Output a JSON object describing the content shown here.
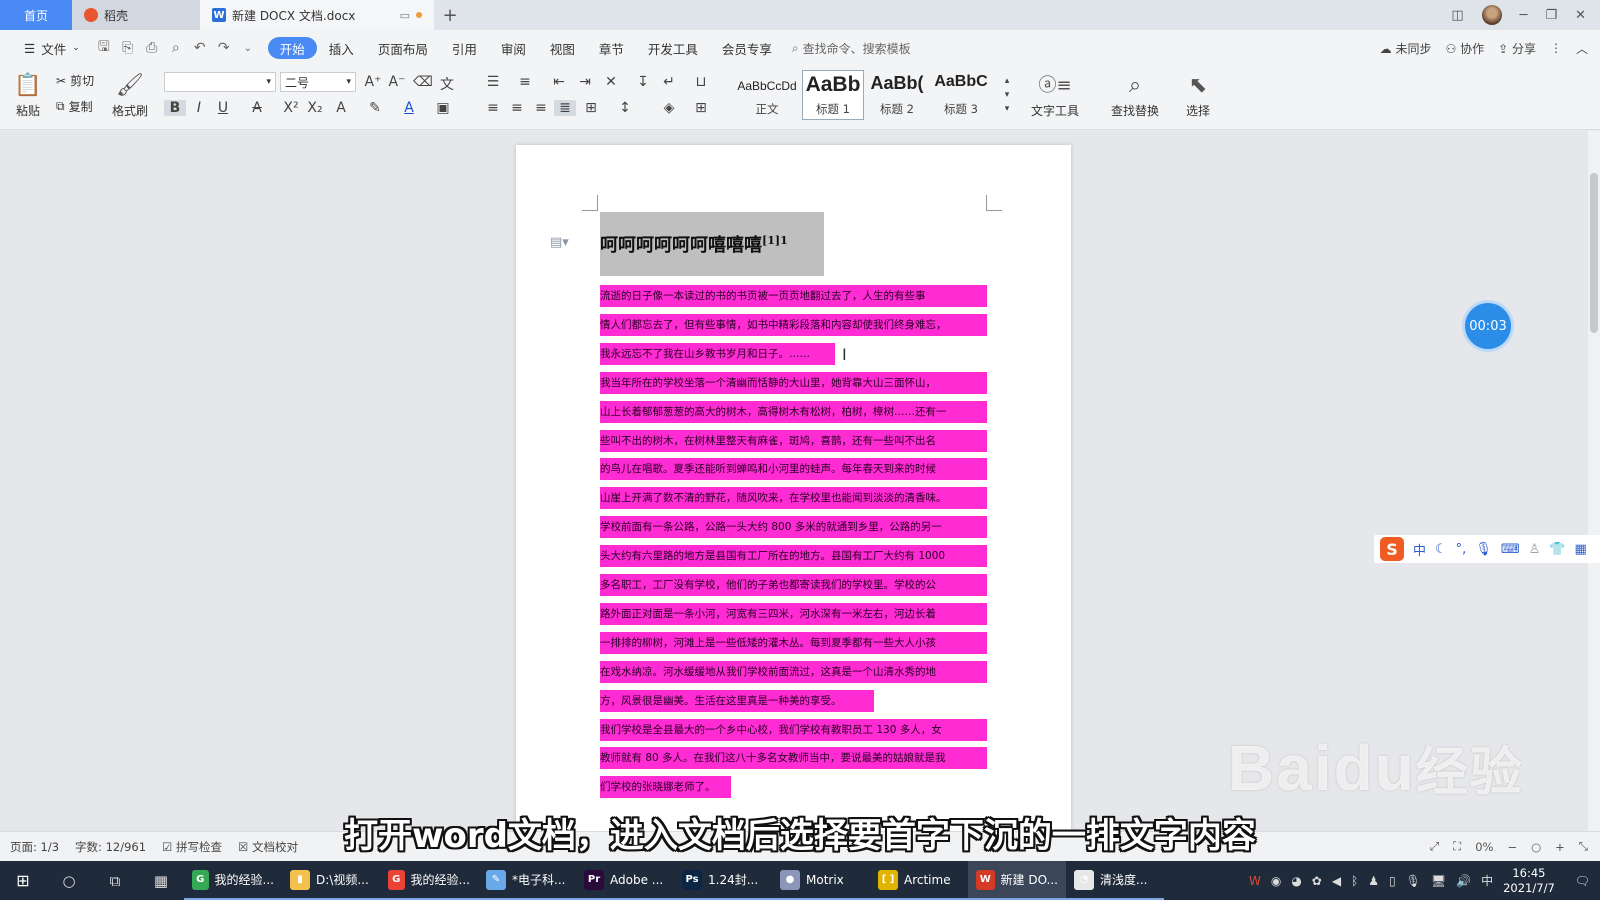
{
  "tabs": {
    "home": "首页",
    "daoke": "稻壳",
    "doc": "新建 DOCX 文档.docx",
    "add": "+"
  },
  "menubar": {
    "file": "文件",
    "items": [
      "开始",
      "插入",
      "页面布局",
      "引用",
      "审阅",
      "视图",
      "章节",
      "开发工具",
      "会员专享"
    ],
    "search": "查找命令、搜索模板",
    "unsynced": "未同步",
    "collab": "协作",
    "share": "分享"
  },
  "ribbon": {
    "paste": "粘贴",
    "cut": "剪切",
    "copy": "复制",
    "format_painter": "格式刷",
    "font_name": "",
    "font_size": "二号",
    "styles": [
      {
        "sample": "AaBbCcDd",
        "label": "正文"
      },
      {
        "sample": "AaBb",
        "label": "标题 1"
      },
      {
        "sample": "AaBb(",
        "label": "标题 2"
      },
      {
        "sample": "AaBbC",
        "label": "标题 3"
      }
    ],
    "text_tools": "文字工具",
    "find_replace": "查找替换",
    "select": "选择"
  },
  "document": {
    "title": "呵呵呵呵呵呵嘻嘻嘻",
    "title_sup": "[1]",
    "title_tail": "1",
    "lines": [
      "  流逝的日子像一本读过的书的书页被一页页地翻过去了，人生的有些事",
      "情人们都忘去了，但有些事情，如书中精彩段落和内容却使我们终身难忘，",
      "我永远忘不了我在山乡教书岁月和日子。……",
      "我当年所在的学校坐落一个清幽而恬静的大山里，她背靠大山三面怀山，",
      "山上长着郁郁葱葱的高大的树木，高得树木有松树，柏树，樟树……还有一",
      "些叫不出的树木，在树林里整天有麻雀，斑鸠，喜鹊，还有一些叫不出名",
      "的鸟儿在唱歌。夏季还能听到蝉鸣和小河里的蛙声。每年春天到来的时候",
      "山崖上开满了数不清的野花，随风吹来，在学校里也能闻到淡淡的清香味。",
      "学校前面有一条公路，公路一头大约 800 多米的就通到乡里，公路的另一",
      "头大约有六里路的地方是县国有工厂所在的地方。县国有工厂大约有 1000",
      "多名职工，工厂没有学校，他们的子弟也都寄读我们的学校里。学校的公",
      "路外面正对面是一条小河，河宽有三四米，河水深有一米左右，河边长着",
      "一排排的柳树，河滩上是一些低矮的灌木丛。每到夏季都有一些大人小孩",
      "在戏水纳凉。河水缓缓地从我们学校前面流过，这真是一个山清水秀的地",
      "方，风景很是幽美。生活在这里真是一种美的享受。",
      "我们学校是全县最大的一个乡中心校，我们学校有教职员工 130 多人，女",
      "教师就有 80 多人。在我们这八十多名女教师当中，要说最美的姑娘就是我",
      "们学校的张晓娜老师了。"
    ],
    "line_widths": [
      1,
      1,
      0.606,
      1,
      1,
      1,
      1,
      1,
      1,
      1,
      1,
      1,
      1,
      1,
      0.708,
      1,
      1,
      0.338
    ]
  },
  "timer": "00:03",
  "ime": {
    "lang": "中"
  },
  "status": {
    "page": "页面: 1/3",
    "words": "字数: 12/961",
    "spell": "拼写检查",
    "proof": "文档校对",
    "zoom": "0%"
  },
  "caption": "打开word文档，进入文档后选择要首字下沉的一排文字内容",
  "watermark": {
    "brand": "Baidu",
    "cn": "经验"
  },
  "taskbar": {
    "apps": [
      {
        "label": "我的经验...",
        "color": "#34a853",
        "glyph": "G"
      },
      {
        "label": "D:\\视频...",
        "color": "#f2c14e",
        "glyph": "▮"
      },
      {
        "label": "我的经验...",
        "color": "#ea4335",
        "glyph": "G"
      },
      {
        "label": "*电子科...",
        "color": "#6aa9e9",
        "glyph": "✎"
      },
      {
        "label": "Adobe ...",
        "color": "#2a0a3a",
        "glyph": "Pr"
      },
      {
        "label": "1.24封...",
        "color": "#0b2545",
        "glyph": "Ps"
      },
      {
        "label": "Motrix",
        "color": "#8c96b8",
        "glyph": "●"
      },
      {
        "label": "Arctime",
        "color": "#e0b400",
        "glyph": "[ ]"
      },
      {
        "label": "新建 DO...",
        "color": "#d33b27",
        "glyph": "W"
      },
      {
        "label": "清浅度...",
        "color": "#e8e8e8",
        "glyph": "◔"
      }
    ],
    "tray_lang": "中",
    "time": "16:45",
    "date": "2021/7/7"
  }
}
